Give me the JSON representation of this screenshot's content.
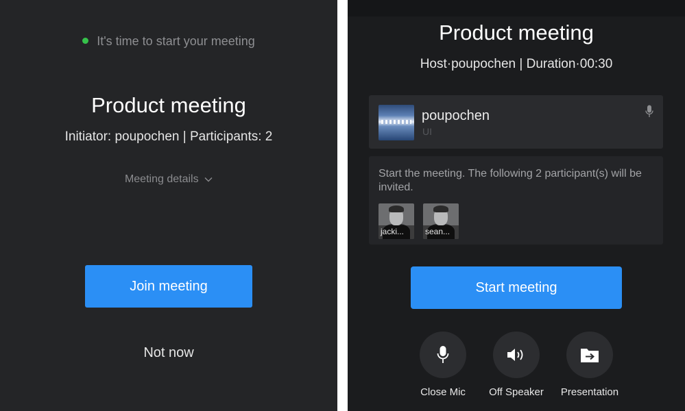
{
  "left": {
    "status": "It's time to start your meeting",
    "title": "Product meeting",
    "meta": "Initiator:  poupochen | Participants: 2",
    "details": "Meeting details",
    "join_label": "Join meeting",
    "not_now_label": "Not now"
  },
  "right": {
    "title": "Product meeting",
    "meta": "Host·poupochen | Duration·00:30",
    "host": {
      "name": "poupochen",
      "sub": "UI"
    },
    "invite_text": "Start the meeting. The following 2 participant(s) will be invited.",
    "participants": [
      {
        "label": "jacki..."
      },
      {
        "label": "sean..."
      }
    ],
    "start_label": "Start meeting",
    "controls": [
      {
        "label": "Close Mic",
        "icon": "mic-icon"
      },
      {
        "label": "Off Speaker",
        "icon": "speaker-icon"
      },
      {
        "label": "Presentation",
        "icon": "share-folder-icon"
      }
    ]
  },
  "colors": {
    "accent": "#2b8ff5",
    "status_green": "#36c24b",
    "background": "#242527"
  }
}
